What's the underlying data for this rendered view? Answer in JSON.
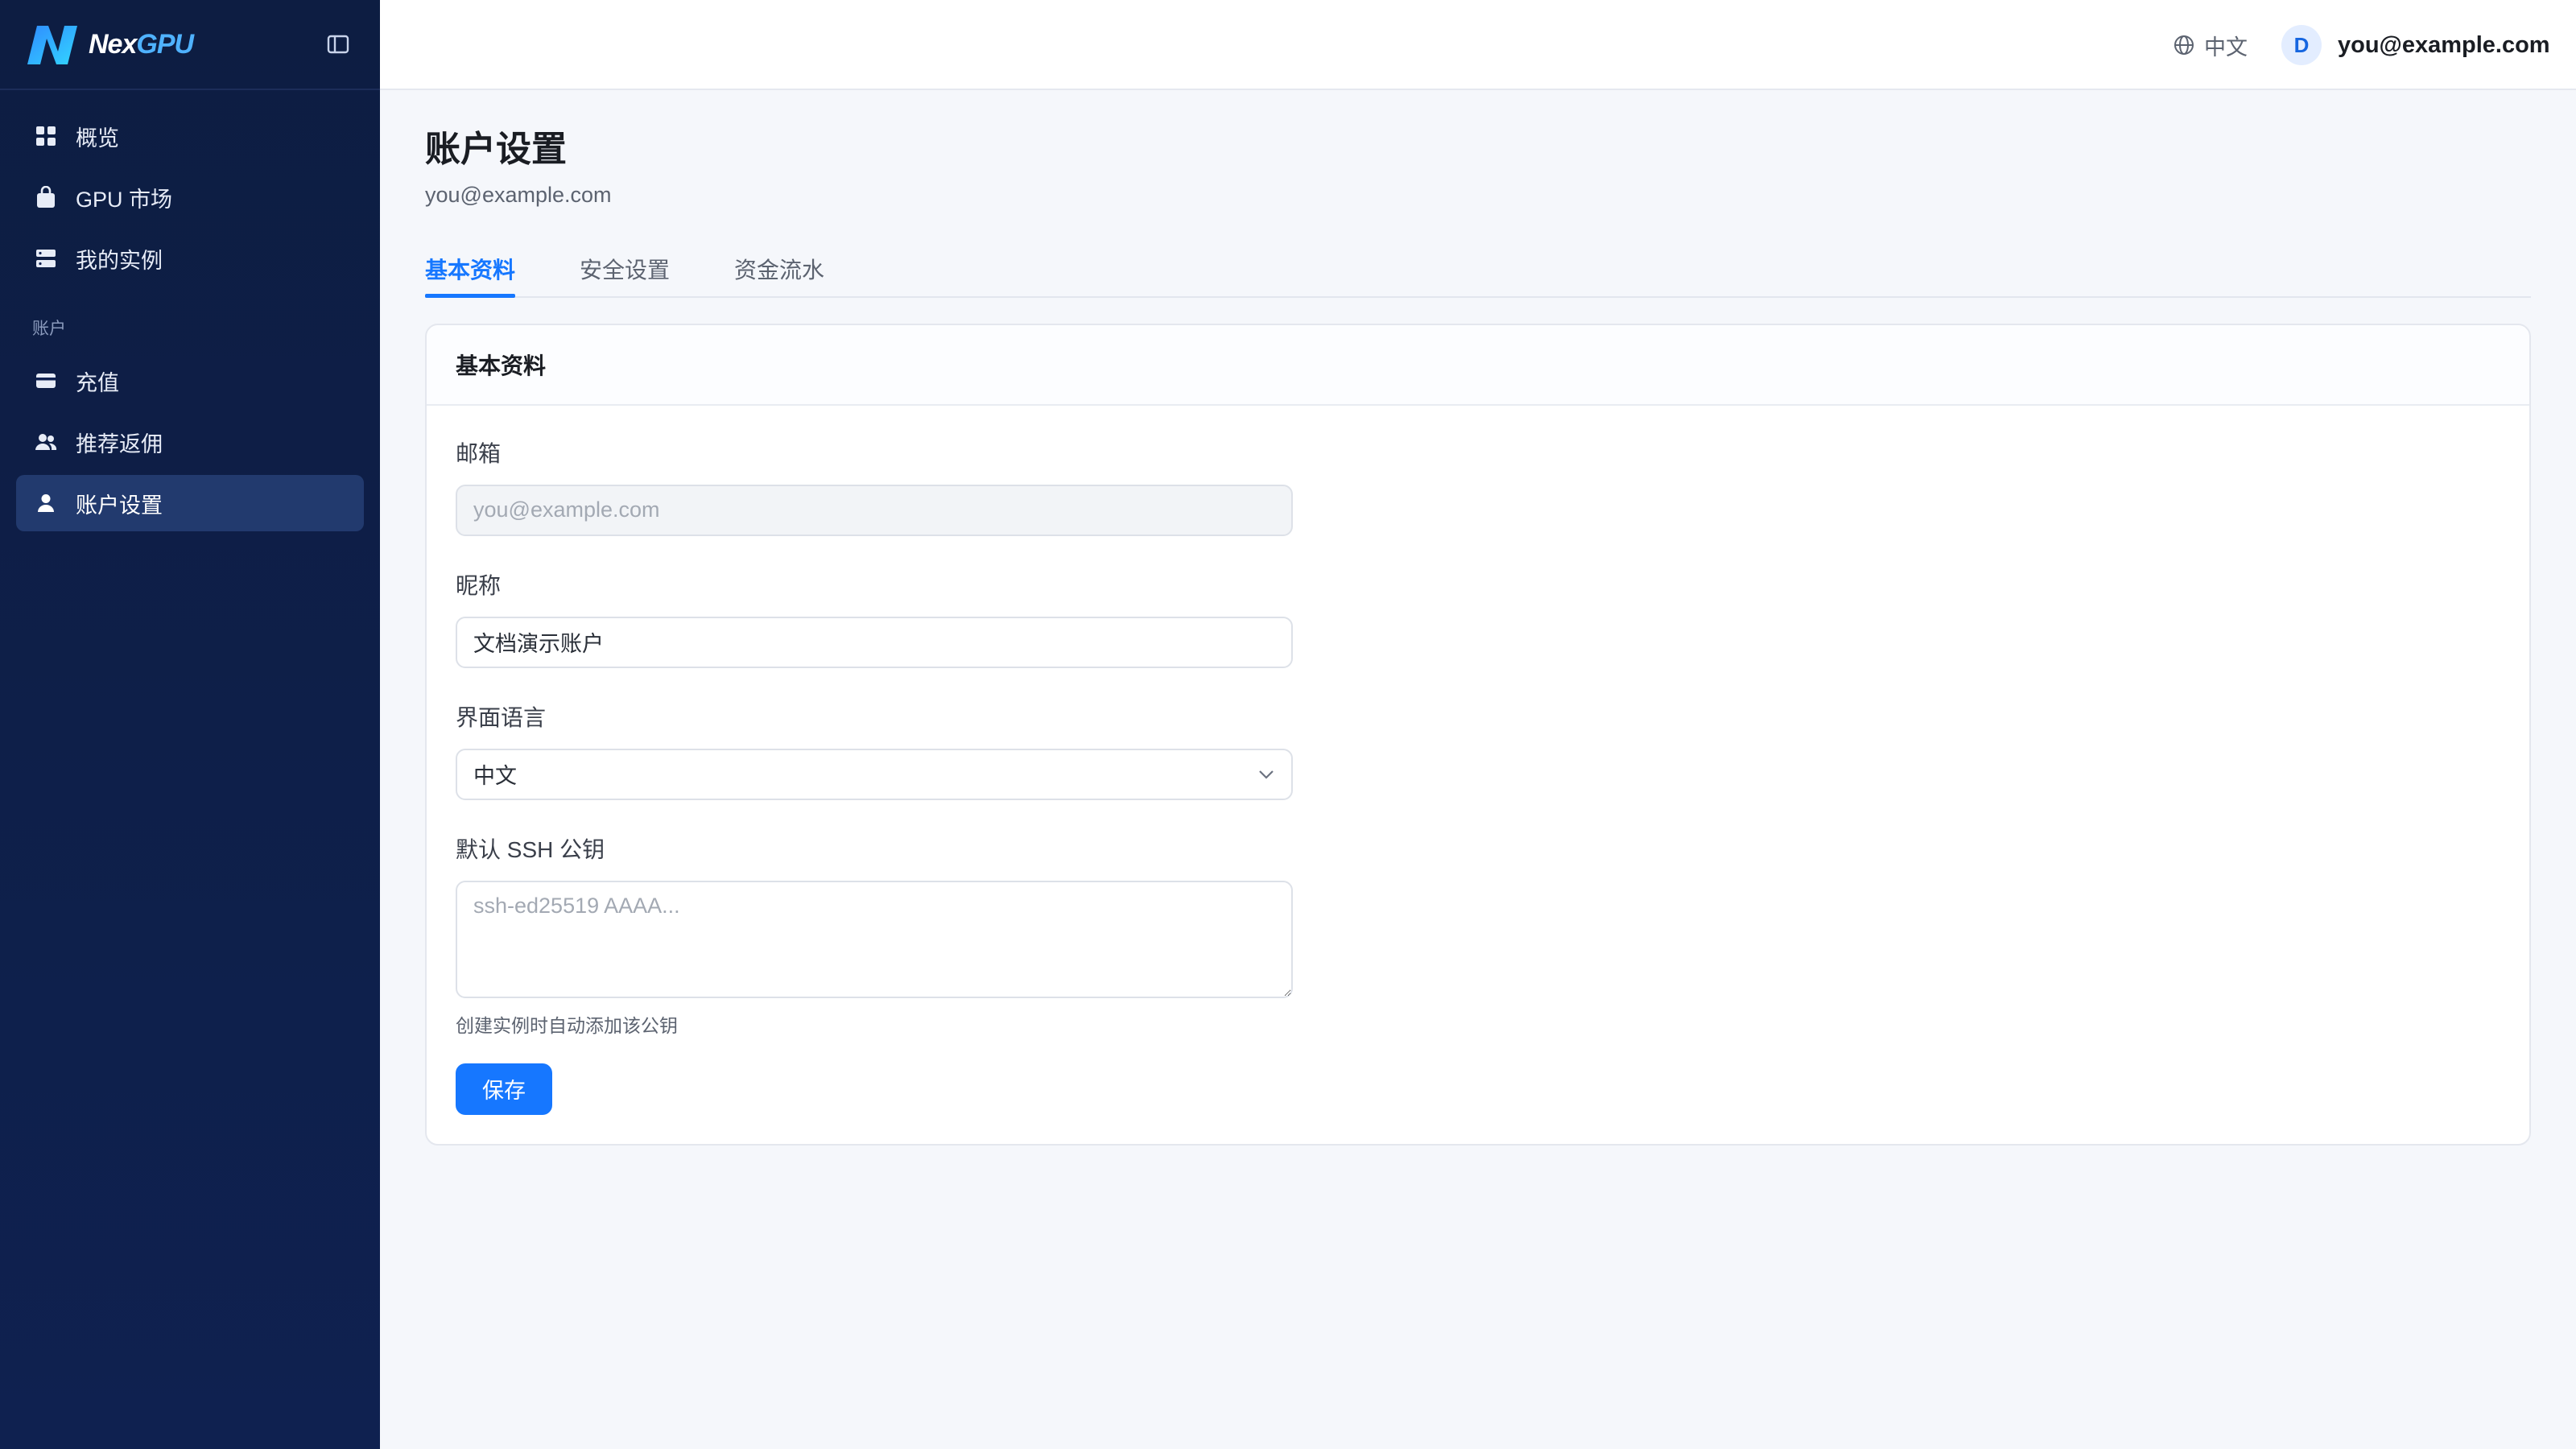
{
  "brand": {
    "name_part1": "Nex",
    "name_part2": "GPU"
  },
  "sidebar": {
    "items": [
      {
        "label": "概览",
        "icon": "grid-icon"
      },
      {
        "label": "GPU 市场",
        "icon": "bag-icon"
      },
      {
        "label": "我的实例",
        "icon": "server-icon"
      }
    ],
    "section_account": "账户",
    "account_items": [
      {
        "label": "充值",
        "icon": "card-icon"
      },
      {
        "label": "推荐返佣",
        "icon": "users-icon"
      },
      {
        "label": "账户设置",
        "icon": "user-icon",
        "active": true
      }
    ]
  },
  "topbar": {
    "language": "中文",
    "avatar_initial": "D",
    "user_email": "you@example.com"
  },
  "page": {
    "title": "账户设置",
    "subtitle": "you@example.com"
  },
  "tabs": [
    {
      "label": "基本资料",
      "active": true
    },
    {
      "label": "安全设置",
      "active": false
    },
    {
      "label": "资金流水",
      "active": false
    }
  ],
  "card": {
    "title": "基本资料",
    "email_label": "邮箱",
    "email_placeholder": "you@example.com",
    "nickname_label": "昵称",
    "nickname_value": "文档演示账户",
    "language_label": "界面语言",
    "language_value": "中文",
    "ssh_label": "默认 SSH 公钥",
    "ssh_placeholder": "ssh-ed25519 AAAA...",
    "ssh_hint": "创建实例时自动添加该公钥",
    "save_label": "保存"
  },
  "colors": {
    "sidebar_bg": "#0d1d42",
    "accent": "#1677ff",
    "active_nav": "#223a6e"
  }
}
